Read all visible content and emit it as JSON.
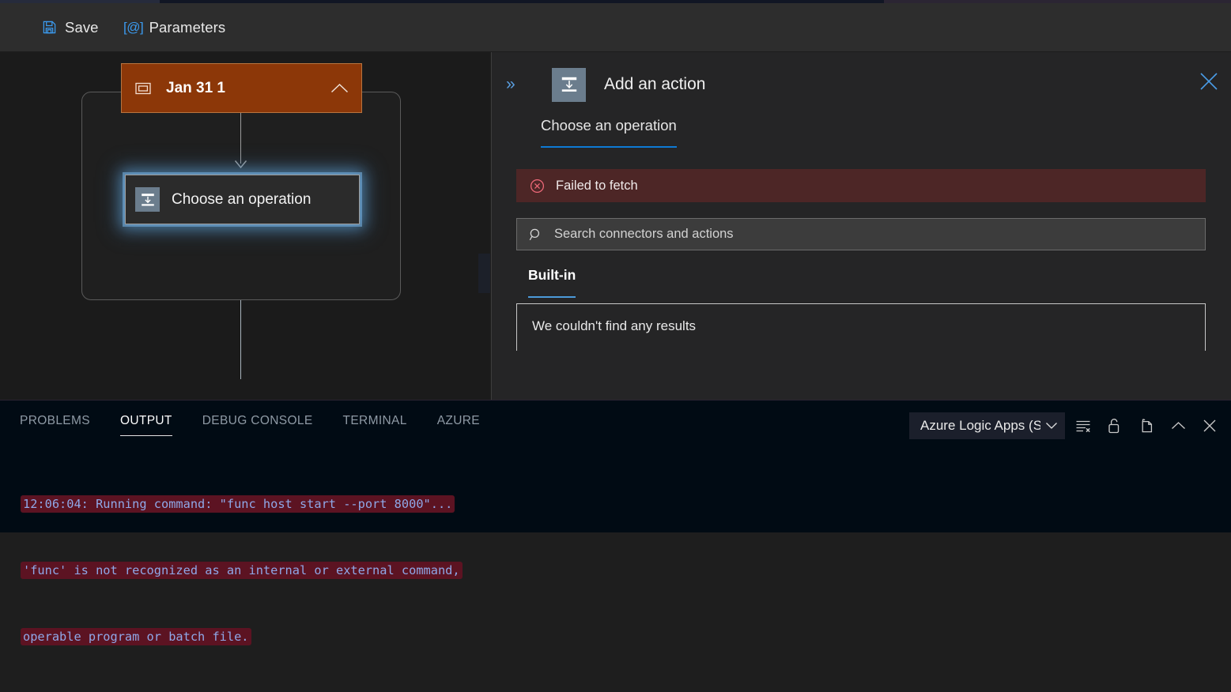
{
  "designer_toolbar": {
    "buttons": [
      {
        "label": "Save",
        "icon": "save-floppy-icon"
      },
      {
        "label": "Parameters",
        "icon": "at-symbol-icon"
      }
    ]
  },
  "designer_canvas": {
    "trigger_node": {
      "title": "Jan 31 1",
      "icon": "window-rectangle-icon",
      "collapse_icon": "chevron-up-icon",
      "color": "#8c3708"
    },
    "operation_node": {
      "title": "Choose an operation",
      "icon": "insert-action-icon",
      "selected": true,
      "glow_color": "#5aa3e0"
    }
  },
  "side_panel": {
    "collapse_icon": "chevrons-right-icon",
    "header_icon": "insert-action-icon",
    "title": "Add an action",
    "close_icon": "close-icon",
    "tabs": [
      {
        "label": "Choose an operation",
        "active": true
      }
    ],
    "error": {
      "icon": "error-circle-icon",
      "message": "Failed to fetch",
      "background": "#4d2626",
      "icon_color": "#f16a7a"
    },
    "search": {
      "icon": "search-icon",
      "placeholder": "Search connectors and actions",
      "value": ""
    },
    "category_tabs": [
      {
        "label": "Built-in",
        "active": true
      }
    ],
    "results": {
      "empty_message": "We couldn't find any results"
    }
  },
  "bottom_panel": {
    "tabs": [
      {
        "label": "PROBLEMS",
        "active": false
      },
      {
        "label": "OUTPUT",
        "active": true
      },
      {
        "label": "DEBUG CONSOLE",
        "active": false
      },
      {
        "label": "TERMINAL",
        "active": false
      },
      {
        "label": "AZURE",
        "active": false
      }
    ],
    "channel_select": {
      "value": "Azure Logic Apps (Stan",
      "chevron_icon": "chevron-down-icon"
    },
    "actions": [
      {
        "icon": "clear-output-icon"
      },
      {
        "icon": "unlock-icon"
      },
      {
        "icon": "new-window-icon"
      },
      {
        "icon": "chevron-up-icon"
      },
      {
        "icon": "close-icon"
      }
    ],
    "output_lines": [
      "12:06:04: Running command: \"func host start --port 8000\"...",
      "'func' is not recognized as an internal or external command,",
      "operable program or batch file."
    ]
  }
}
